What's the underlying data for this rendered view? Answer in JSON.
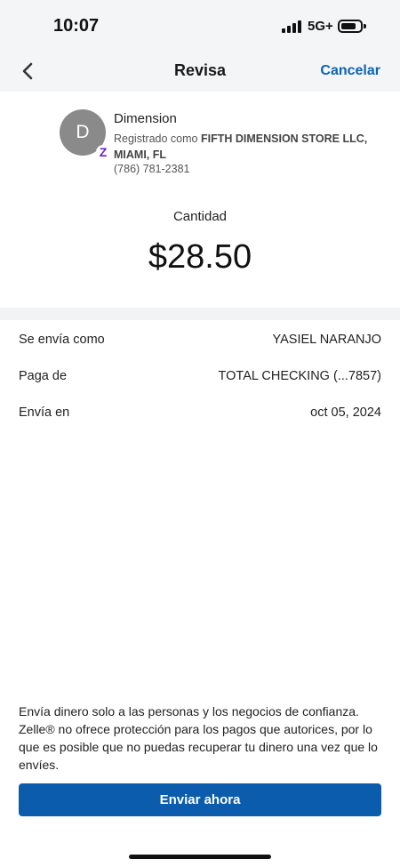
{
  "status_bar": {
    "time": "10:07",
    "network": "5G+",
    "signal_icon": "signal-icon",
    "battery_icon": "battery-icon"
  },
  "nav": {
    "title": "Revisa",
    "cancel_label": "Cancelar",
    "back_icon": "chevron-left-icon"
  },
  "recipient": {
    "initial": "D",
    "name": "Dimension",
    "registered_prefix": "Registrado como",
    "registered_name": "FIFTH DIMENSION STORE LLC, MIAMI, FL",
    "phone": "(786) 781-2381",
    "badge_icon": "zelle-icon",
    "badge_glyph": "Z"
  },
  "amount": {
    "label": "Cantidad",
    "value": "$28.50"
  },
  "details": [
    {
      "label": "Se envía como",
      "value": "YASIEL NARANJO"
    },
    {
      "label": "Paga de",
      "value": "TOTAL CHECKING (...7857)"
    },
    {
      "label": "Envía en",
      "value": "oct 05, 2024"
    }
  ],
  "disclaimer": "Envía dinero solo a las personas y los negocios de confianza. Zelle® no ofrece protección para los pagos que autorices, por lo que es posible que no puedas recuperar tu dinero una vez que lo envíes.",
  "send_button_label": "Enviar ahora",
  "colors": {
    "accent": "#0b5cad",
    "link": "#0b63b6",
    "zelle": "#6d1ed4",
    "avatar": "#8a8a8a"
  }
}
